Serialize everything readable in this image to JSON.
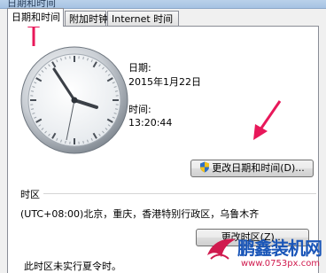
{
  "window": {
    "title_fragment": "日期和时间"
  },
  "tabs": [
    {
      "label": "日期和时间",
      "active": true
    },
    {
      "label": "附加时钟",
      "active": false
    },
    {
      "label": "Internet 时间",
      "active": false
    }
  ],
  "date": {
    "label": "日期:",
    "value": "2015年1月22日"
  },
  "time": {
    "label": "时间:",
    "value": "13:20:44"
  },
  "buttons": {
    "change_datetime": "更改日期和时间(D)...",
    "change_timezone": "更改时区(Z)..."
  },
  "timezone": {
    "heading": "时区",
    "value": "(UTC+08:00)北京，重庆，香港特别行政区，乌鲁木齐",
    "dst_note": "此时区未实行夏令时。"
  },
  "watermark": {
    "brand": "鹏鑫装机网",
    "url": "www.0753px.com"
  },
  "colors": {
    "annotation_arrow": "#e8185a",
    "shield_blue": "#2f6fc6",
    "shield_yellow": "#f4c21a"
  }
}
